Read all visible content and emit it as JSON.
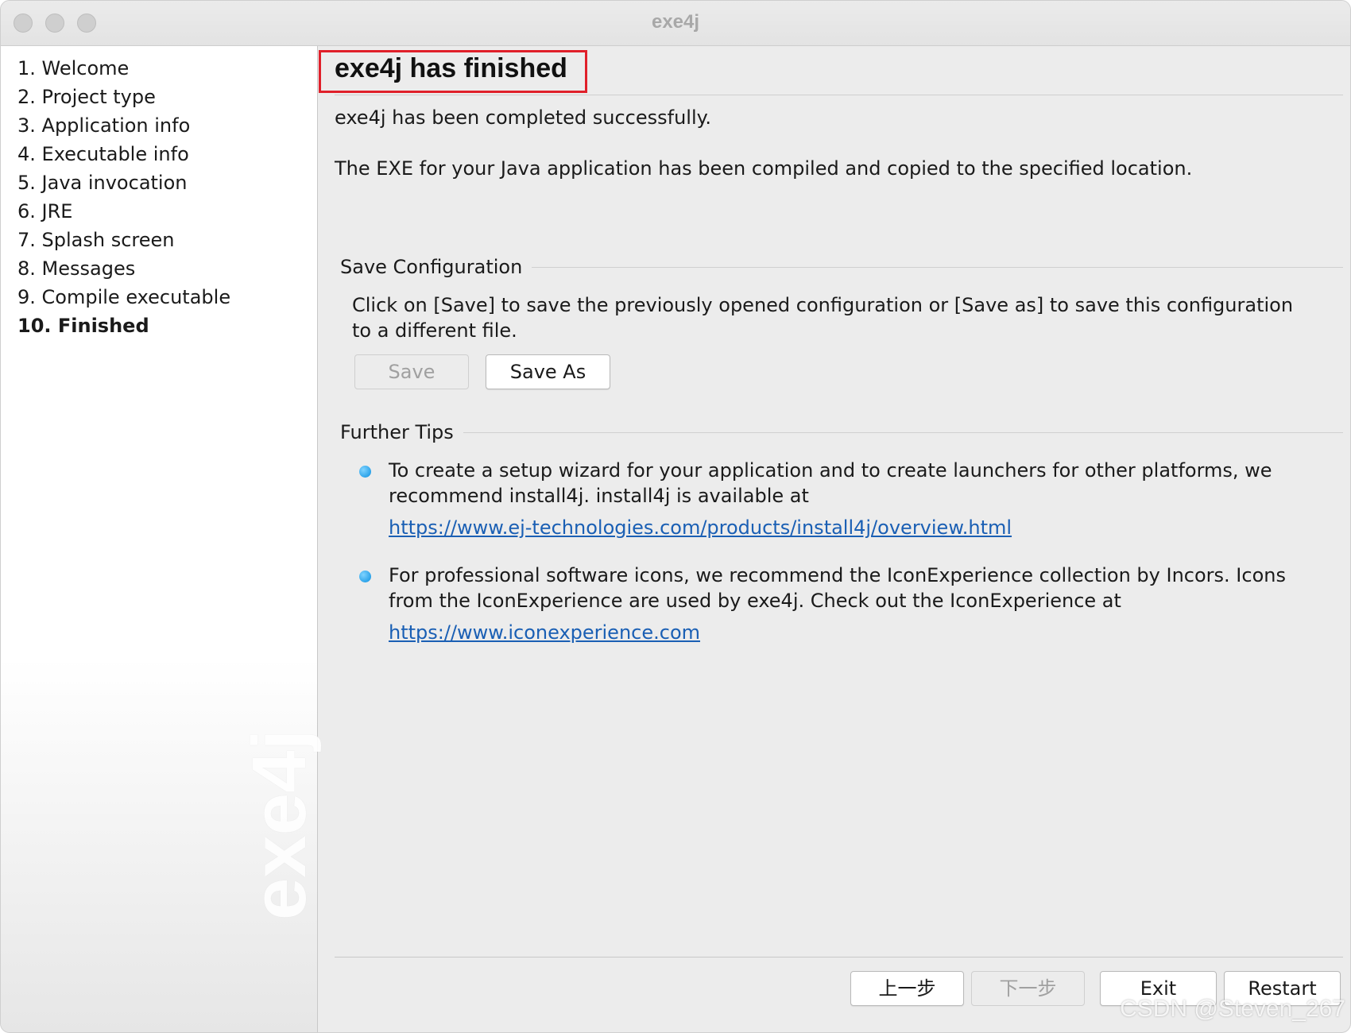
{
  "window": {
    "title": "exe4j"
  },
  "sidebar": {
    "steps": [
      {
        "label": "1. Welcome"
      },
      {
        "label": "2. Project type"
      },
      {
        "label": "3. Application info"
      },
      {
        "label": "4. Executable info"
      },
      {
        "label": "5. Java invocation"
      },
      {
        "label": "6. JRE"
      },
      {
        "label": "7. Splash screen"
      },
      {
        "label": "8. Messages"
      },
      {
        "label": "9. Compile executable"
      },
      {
        "label": "10. Finished",
        "current": true
      }
    ],
    "logo": "exe4j"
  },
  "main": {
    "title": "exe4j has finished",
    "intro": "exe4j has been completed successfully.",
    "description": "The EXE for your Java application has been compiled and copied to the specified location.",
    "save_configuration": {
      "label": "Save Configuration",
      "text_line1": "Click on [Save] to save the previously opened configuration or [Save as] to save this configuration",
      "text_line2": "to a different file.",
      "save_button": "Save",
      "save_as_button": "Save As"
    },
    "further_tips": {
      "label": "Further Tips",
      "tips": [
        {
          "line1": "To create a setup wizard for your application and to create launchers for other platforms, we",
          "line2": "recommend install4j. install4j is available at",
          "link": "https://www.ej-technologies.com/products/install4j/overview.html"
        },
        {
          "line1": "For professional software icons, we recommend the IconExperience collection by Incors. Icons",
          "line2": "from the IconExperience are used by exe4j. Check out the IconExperience at",
          "link": "https://www.iconexperience.com"
        }
      ]
    }
  },
  "footer": {
    "back_button": "上一步",
    "next_button": "下一步",
    "exit_button": "Exit",
    "restart_button": "Restart"
  },
  "watermark": "CSDN @Steven_267",
  "colors": {
    "highlight_box": "#e0202a",
    "link": "#1a5fb4",
    "bullet": "#0a8fe0"
  }
}
